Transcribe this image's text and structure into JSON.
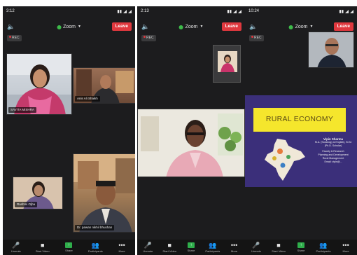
{
  "panels": [
    {
      "status_time": "3:12",
      "zoom_label": "Zoom",
      "leave_label": "Leave",
      "rec_label": "REC",
      "tiles": [
        {
          "name": "SAVITA MISHRA"
        },
        {
          "name": "Anis Ali Shaikh"
        },
        {
          "name": "Rashmi Ojha"
        },
        {
          "name": "Dr. pawan nikhil bhushan"
        }
      ],
      "controls": [
        "Unmute",
        "Start Video",
        "Share",
        "Participants",
        "More"
      ]
    },
    {
      "status_time": "2:13",
      "zoom_label": "Zoom",
      "leave_label": "Leave",
      "rec_label": "REC",
      "controls": [
        "Unmute",
        "Start Video",
        "Share",
        "Participants",
        "More"
      ]
    },
    {
      "status_time": "10:24",
      "zoom_label": "Zoom",
      "leave_label": "Leave",
      "rec_label": "REC",
      "slide": {
        "title": "RURAL ECONOMY",
        "author_lines": [
          "Vipin Sharma",
          "M.A. (Sociology & English), B.Ed",
          "(Ph.D. Scholar)",
          "Faculty & Research",
          "Planning and Development",
          "Rural Management",
          "Email: vipin@..."
        ]
      },
      "controls": [
        "Unmute",
        "Start Video",
        "Share",
        "Participants",
        "More"
      ]
    }
  ],
  "icons": {
    "audio": "speaker-icon",
    "unmute": "mic-muted-icon",
    "video": "video-off-icon",
    "share": "share-screen-icon",
    "participants": "people-icon",
    "more": "more-dots-icon"
  },
  "colors": {
    "leave": "#e0383e",
    "share": "#2fae4b",
    "slide_bg": "#3b2f7a",
    "slide_title_bg": "#f5e62c"
  }
}
